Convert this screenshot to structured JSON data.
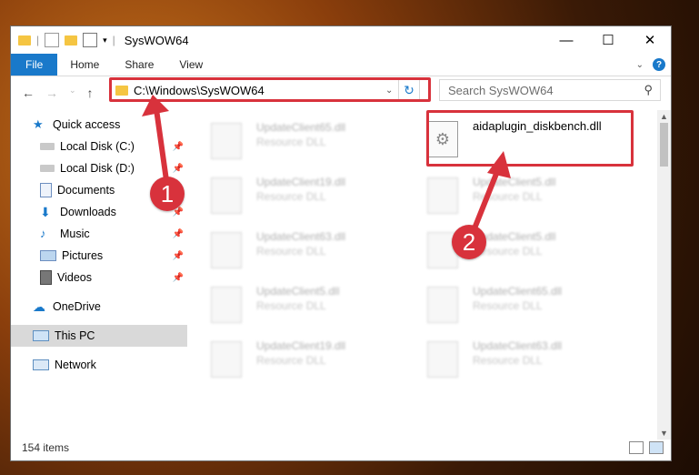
{
  "window": {
    "title": "SysWOW64",
    "controls": {
      "minimize": "—",
      "maximize": "☐",
      "close": "✕"
    }
  },
  "ribbon": {
    "tabs": [
      "File",
      "Home",
      "Share",
      "View"
    ],
    "help": "?"
  },
  "address": {
    "path": "C:\\Windows\\SysWOW64"
  },
  "search": {
    "placeholder": "Search SysWOW64"
  },
  "sidebar": {
    "items": [
      {
        "label": "Quick access",
        "icon": "star-icon",
        "pinned": false
      },
      {
        "label": "Local Disk (C:)",
        "icon": "drive-icon",
        "pinned": true
      },
      {
        "label": "Local Disk (D:)",
        "icon": "drive-icon",
        "pinned": true
      },
      {
        "label": "Documents",
        "icon": "documents-icon",
        "pinned": true
      },
      {
        "label": "Downloads",
        "icon": "download-icon",
        "pinned": true
      },
      {
        "label": "Music",
        "icon": "music-icon",
        "pinned": true
      },
      {
        "label": "Pictures",
        "icon": "pictures-icon",
        "pinned": true
      },
      {
        "label": "Videos",
        "icon": "videos-icon",
        "pinned": true
      },
      {
        "label": "OneDrive",
        "icon": "cloud-icon",
        "pinned": false
      },
      {
        "label": "This PC",
        "icon": "computer-icon",
        "pinned": false,
        "selected": true
      },
      {
        "label": "Network",
        "icon": "network-icon",
        "pinned": false
      }
    ]
  },
  "files": {
    "left": [
      {
        "name": "UpdateClient65.dll",
        "type": "Resource DLL"
      },
      {
        "name": "UpdateClient19.dll",
        "type": "Resource DLL"
      },
      {
        "name": "UpdateClient63.dll",
        "type": "Resource DLL"
      },
      {
        "name": "UpdateClient5.dll",
        "type": "Resource DLL"
      },
      {
        "name": "UpdateClient19.dll",
        "type": "Resource DLL"
      }
    ],
    "right": [
      {
        "name": "aidaplugin_diskbench.dll",
        "type": ""
      },
      {
        "name": "UpdateClient5.dll",
        "type": "Resource DLL"
      },
      {
        "name": "UpdateClient5.dll",
        "type": "Resource DLL"
      },
      {
        "name": "UpdateClient65.dll",
        "type": "Resource DLL"
      },
      {
        "name": "UpdateClient63.dll",
        "type": "Resource DLL"
      }
    ]
  },
  "status": {
    "count": "154 items"
  },
  "annotations": {
    "step1": "1",
    "step2": "2",
    "color": "#d8323c"
  }
}
